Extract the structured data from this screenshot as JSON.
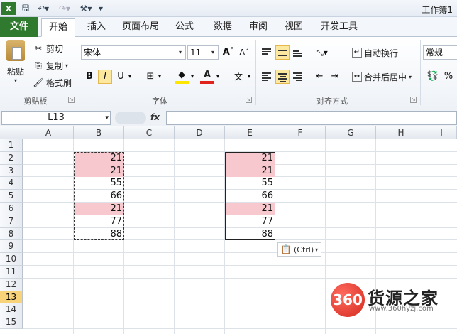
{
  "window": {
    "title": "工作簿1"
  },
  "tabs": [
    "文件",
    "开始",
    "插入",
    "页面布局",
    "公式",
    "数据",
    "审阅",
    "视图",
    "开发工具"
  ],
  "ribbon": {
    "clipboard": {
      "paste": "粘贴",
      "cut": "剪切",
      "copy": "复制",
      "format_painter": "格式刷",
      "label": "剪贴板"
    },
    "font": {
      "name": "宋体",
      "size": "11",
      "bold": "B",
      "italic": "I",
      "underline": "U",
      "label": "字体"
    },
    "alignment": {
      "wrap": "自动换行",
      "merge": "合并后居中",
      "label": "对齐方式"
    },
    "number": {
      "format": "常规"
    }
  },
  "formula_bar": {
    "name_box": "L13",
    "fx": "fx"
  },
  "columns": [
    "A",
    "B",
    "C",
    "D",
    "E",
    "F",
    "G",
    "H",
    "I"
  ],
  "rows": [
    "1",
    "2",
    "3",
    "4",
    "5",
    "6",
    "7",
    "8",
    "9",
    "10",
    "11",
    "12",
    "13",
    "14",
    "15"
  ],
  "active_row": "13",
  "cells": {
    "B": [
      {
        "row": 2,
        "value": "21",
        "highlight": true
      },
      {
        "row": 3,
        "value": "21",
        "highlight": true
      },
      {
        "row": 4,
        "value": "55",
        "highlight": false
      },
      {
        "row": 5,
        "value": "66",
        "highlight": false
      },
      {
        "row": 6,
        "value": "21",
        "highlight": true
      },
      {
        "row": 7,
        "value": "77",
        "highlight": false
      },
      {
        "row": 8,
        "value": "88",
        "highlight": false
      }
    ],
    "E": [
      {
        "row": 2,
        "value": "21",
        "highlight": true
      },
      {
        "row": 3,
        "value": "21",
        "highlight": true
      },
      {
        "row": 4,
        "value": "55",
        "highlight": false
      },
      {
        "row": 5,
        "value": "66",
        "highlight": false
      },
      {
        "row": 6,
        "value": "21",
        "highlight": true
      },
      {
        "row": 7,
        "value": "77",
        "highlight": false
      },
      {
        "row": 8,
        "value": "88",
        "highlight": false
      }
    ]
  },
  "highlight_color": "#f8c8cf",
  "paste_options": {
    "label": "(Ctrl)"
  },
  "watermark": {
    "logo": "360",
    "name": "货源之家",
    "url": "www.360hyzj.com"
  }
}
